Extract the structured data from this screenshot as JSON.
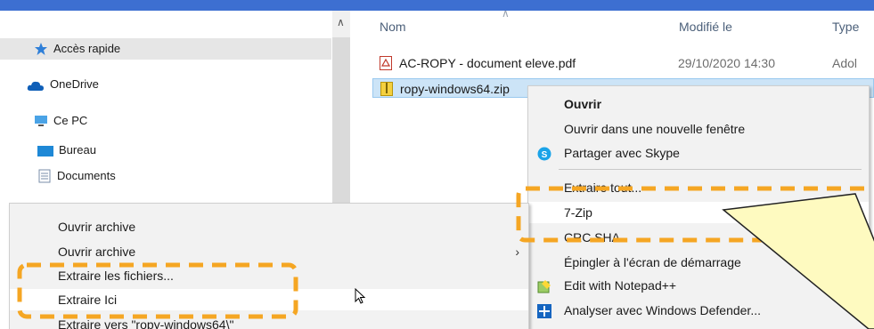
{
  "nav": {
    "items": [
      {
        "label": "Accès rapide",
        "icon": "star-icon"
      },
      {
        "label": "OneDrive",
        "icon": "cloud-icon"
      },
      {
        "label": "Ce PC",
        "icon": "computer-icon"
      },
      {
        "label": "Bureau",
        "icon": "desktop-folder-icon"
      },
      {
        "label": "Documents",
        "icon": "documents-folder-icon"
      }
    ]
  },
  "columns": {
    "name": "Nom",
    "modified": "Modifié le",
    "type": "Type"
  },
  "files": [
    {
      "name": "AC-ROPY - document eleve.pdf",
      "modified": "29/10/2020 14:30",
      "type": "Adol",
      "icon": "pdf-file-icon"
    },
    {
      "name": "ropy-windows64.zip",
      "modified": "",
      "type": "",
      "icon": "zip-file-icon"
    }
  ],
  "context_menu": {
    "open": "Ouvrir",
    "open_new_window": "Ouvrir dans une nouvelle fenêtre",
    "share_skype": "Partager avec Skype",
    "extract_all": "Extraire tout...",
    "seven_zip": "7-Zip",
    "crc_sha": "CRC SHA",
    "pin_start": "Épingler à l'écran de démarrage",
    "edit_notepad": "Edit with Notepad++",
    "defender": "Analyser avec Windows Defender..."
  },
  "submenu": {
    "open_archive_1": "Ouvrir archive",
    "open_archive_2": "Ouvrir archive",
    "extract_files": "Extraire les fichiers...",
    "extract_here": "Extraire Ici",
    "extract_to": "Extraire vers \"ropy-windows64\\\""
  },
  "colors": {
    "desktop": "#3d6fd1",
    "highlight_dash": "#f5a623",
    "callout_fill": "#fefac0",
    "selection": "#cce4f7"
  }
}
